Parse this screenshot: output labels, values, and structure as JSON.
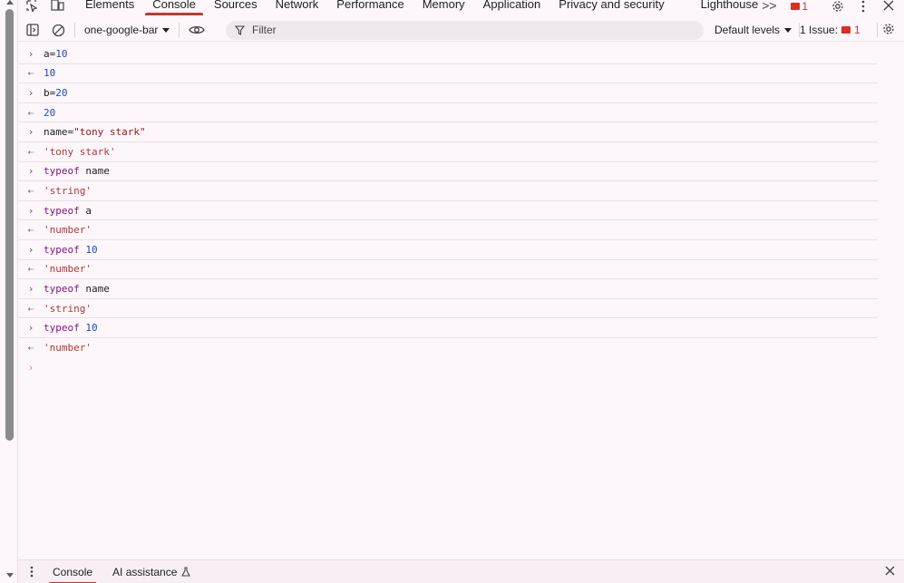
{
  "tabs": [
    {
      "label": "Elements"
    },
    {
      "label": "Console"
    },
    {
      "label": "Sources"
    },
    {
      "label": "Network"
    },
    {
      "label": "Performance"
    },
    {
      "label": "Memory"
    },
    {
      "label": "Application"
    },
    {
      "label": "Privacy and security"
    },
    {
      "label": "Lighthouse"
    }
  ],
  "topbar": {
    "more_tabs": ">>",
    "issues_count": "1"
  },
  "toolbar": {
    "context": "one-google-bar",
    "filter_placeholder": "Filter",
    "levels": "Default levels",
    "issues_label": "1 Issue:",
    "issues_count": "1"
  },
  "console": {
    "entries": [
      {
        "kind": "in",
        "text": "a=10"
      },
      {
        "kind": "out",
        "text": "10"
      },
      {
        "kind": "in",
        "text": "b=20"
      },
      {
        "kind": "out",
        "text": "20"
      },
      {
        "kind": "in",
        "text": "name=\"tony stark\""
      },
      {
        "kind": "out",
        "text": "'tony stark'"
      },
      {
        "kind": "in",
        "text": "typeof name"
      },
      {
        "kind": "out",
        "text": "'string'"
      },
      {
        "kind": "in",
        "text": "typeof a"
      },
      {
        "kind": "out",
        "text": "'number'"
      },
      {
        "kind": "in",
        "text": "typeof 10"
      },
      {
        "kind": "out",
        "text": "'number'"
      },
      {
        "kind": "in",
        "text": "typeof name"
      },
      {
        "kind": "out",
        "text": "'string'"
      },
      {
        "kind": "in",
        "text": "typeof 10"
      },
      {
        "kind": "out",
        "text": "'number'"
      }
    ]
  },
  "drawer": {
    "tabs": [
      {
        "label": "Console"
      },
      {
        "label": "AI assistance"
      }
    ]
  },
  "colors": {
    "accent": "#c0392b",
    "keyword": "#881280",
    "number": "#1a4bc4",
    "string": "#a31515"
  }
}
